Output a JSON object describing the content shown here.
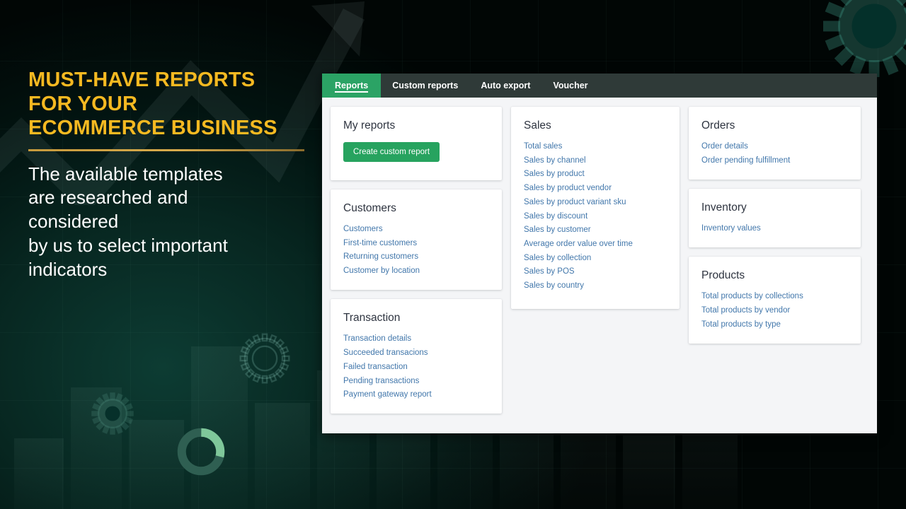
{
  "promo": {
    "headline_lines": [
      "MUST-HAVE REPORTS",
      "FOR YOUR",
      "ECOMMERCE BUSINESS"
    ],
    "subcopy_lines": [
      "The available templates",
      "are researched and",
      "considered",
      "by us to select important",
      "indicators"
    ],
    "headline_color": "#f5b921",
    "subcopy_color": "#ffffff",
    "divider_color": "#c79a3c"
  },
  "app": {
    "accent_green": "#2ba365",
    "tabbar_color": "#2f3a38",
    "link_color": "#4277ab",
    "body_color": "#f4f5f7",
    "tabs": [
      {
        "label": "Reports",
        "active": true
      },
      {
        "label": "Custom reports",
        "active": false
      },
      {
        "label": "Auto export",
        "active": false
      },
      {
        "label": "Voucher",
        "active": false
      }
    ],
    "cards": {
      "my_reports": {
        "title": "My reports",
        "button_label": "Create custom report"
      },
      "customers": {
        "title": "Customers",
        "links": [
          "Customers",
          "First-time customers",
          "Returning customers",
          "Customer by location"
        ]
      },
      "transaction": {
        "title": "Transaction",
        "links": [
          "Transaction details",
          "Succeeded transacions",
          "Failed transaction",
          "Pending transactions",
          "Payment gateway report"
        ]
      },
      "sales": {
        "title": "Sales",
        "links": [
          "Total sales",
          "Sales by channel",
          "Sales by product",
          "Sales by product vendor",
          "Sales by product variant sku",
          "Sales by discount",
          "Sales by customer",
          "Average order value over time",
          "Sales by collection",
          "Sales by POS",
          "Sales by country"
        ]
      },
      "orders": {
        "title": "Orders",
        "links": [
          "Order details",
          "Order pending fulfillment"
        ]
      },
      "inventory": {
        "title": "Inventory",
        "links": [
          "Inventory values"
        ]
      },
      "products": {
        "title": "Products",
        "links": [
          "Total products by collections",
          "Total products by vendor",
          "Total products by type"
        ]
      }
    }
  },
  "decor": {
    "arrow_icon": "growth-arrow-icon",
    "gear_icons": [
      "gear-icon-large",
      "gear-icon-small",
      "gear-icon-corner"
    ],
    "donut_icon": "donut-chart-icon"
  }
}
